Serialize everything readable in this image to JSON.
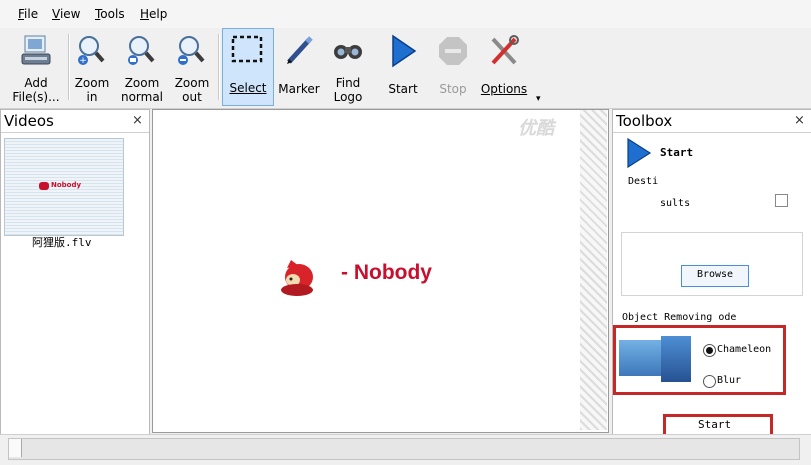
{
  "menu": {
    "items": [
      "File",
      "View",
      "Tools",
      "Help"
    ],
    "mnemonics": [
      "F",
      "V",
      "T",
      "H"
    ],
    "rests": [
      "ile",
      "iew",
      "ools",
      "elp"
    ]
  },
  "toolbar": {
    "add_files": "Add\nFile(s)...",
    "zoom_in": "Zoom\nin",
    "zoom_normal": "Zoom\nnormal",
    "zoom_out": "Zoom\nout",
    "select": "Select",
    "marker": "Marker",
    "find_logo": "Find\nLogo",
    "start": "Start",
    "stop": "Stop",
    "options": "Options",
    "overflow": "▾"
  },
  "videos_panel": {
    "title": "Videos",
    "close": "×",
    "thumb_text": "Nobody",
    "file_name": "阿狸版.flv"
  },
  "preview": {
    "logo_text": "- Nobody",
    "watermark": "优酷"
  },
  "toolbox": {
    "title": "Toolbox",
    "close": "×",
    "start_label": "Start",
    "destination_label": "Desti",
    "results_label": "sults",
    "browse": "Browse",
    "mode_label": "Object Removing ode",
    "modes": [
      "Chameleon",
      "Blur"
    ],
    "selected_mode": "Chameleon",
    "start_button": "Start"
  },
  "colors": {
    "accent": "#c62828",
    "selection": "#cfe5fb",
    "logo_red": "#c8102e"
  }
}
